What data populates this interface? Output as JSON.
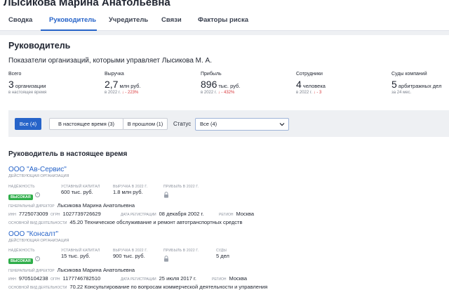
{
  "header": {
    "person_name": "Лысикова Марина Анатольевна"
  },
  "tabs": [
    {
      "label": "Сводка"
    },
    {
      "label": "Руководитель"
    },
    {
      "label": "Учредитель"
    },
    {
      "label": "Связи"
    },
    {
      "label": "Факторы риска"
    }
  ],
  "section": {
    "title": "Руководитель",
    "subtitle": "Показатели организаций, которыми управляет Лысикова М. А."
  },
  "stats": {
    "total": {
      "label": "Всего",
      "value": "3",
      "unit": "организации",
      "note": "в настоящее время"
    },
    "revenue": {
      "label": "Выручка",
      "value": "2,7",
      "unit": "млн руб.",
      "note": "в 2022 г.",
      "arrow": "↓",
      "change": "- 223%"
    },
    "profit": {
      "label": "Прибыль",
      "value": "896",
      "unit": "тыс. руб.",
      "note": "в 2022 г.",
      "arrow": "↓",
      "change": "- 432%"
    },
    "employees": {
      "label": "Сотрудники",
      "value": "4",
      "unit": "человека",
      "note": "в 2022 г.",
      "arrow": "↓",
      "change": "- 3"
    },
    "courts": {
      "label": "Суды компаний",
      "value": "5",
      "unit": "арбитражных дел",
      "note": "за 24 мес."
    }
  },
  "filters": {
    "all": "Все (4)",
    "current": "В настоящее время (3)",
    "past": "В прошлом (1)",
    "status_label": "Статус",
    "status_value": "Все (4)"
  },
  "current_title": "Руководитель в настоящее время",
  "orgs": [
    {
      "name": "ООО \"Ав-Сервис\"",
      "status": "ДЕЙСТВУЮЩАЯ ОРГАНИЗАЦИЯ",
      "reliability_label": "НАДЁЖНОСТЬ",
      "reliability": "ВЫСОКАЯ",
      "capital_label": "УСТАВНЫЙ КАПИТАЛ",
      "capital": "600 тыс. руб.",
      "revenue_label": "ВЫРУЧКА В 2022 Г.",
      "revenue": "1.8 млн руб.",
      "profit_label": "ПРИБЫЛЬ В 2022 Г.",
      "director_label": "ГЕНЕРАЛЬНЫЙ ДИРЕКТОР",
      "director": "Лысикова Марина Анатольевна",
      "inn_label": "ИНН",
      "inn": "7725073009",
      "ogrn_label": "ОГРН",
      "ogrn": "1027739726629",
      "reg_label": "ДАТА РЕГИСТРАЦИИ",
      "reg_date": "08 декабря 2002 г.",
      "region_label": "РЕГИОН",
      "region": "Москва",
      "activity_label": "ОСНОВНОЙ ВИД ДЕЯТЕЛЬНОСТИ",
      "activity": "45.20 Техническое обслуживание и ремонт автотранспортных средств"
    },
    {
      "name": "ООО \"Консалт\"",
      "status": "ДЕЙСТВУЮЩАЯ ОРГАНИЗАЦИЯ",
      "reliability_label": "НАДЁЖНОСТЬ",
      "reliability": "ВЫСОКАЯ",
      "capital_label": "УСТАВНЫЙ КАПИТАЛ",
      "capital": "15 тыс. руб.",
      "revenue_label": "ВЫРУЧКА В 2022 Г.",
      "revenue": "900 тыс. руб.",
      "profit_label": "ПРИБЫЛЬ В 2022 Г.",
      "courts_label": "СУДЫ",
      "courts": "5 дел",
      "director_label": "ГЕНЕРАЛЬНЫЙ ДИРЕКТОР",
      "director": "Лысикова Марина Анатольевна",
      "inn_label": "ИНН",
      "inn": "9705104238",
      "ogrn_label": "ОГРН",
      "ogrn": "1177746782510",
      "reg_label": "ДАТА РЕГИСТРАЦИИ",
      "reg_date": "25 июля 2017 г.",
      "region_label": "РЕГИОН",
      "region": "Москва",
      "activity_label": "ОСНОВНОЙ ВИД ДЕЯТЕЛЬНОСТИ",
      "activity": "70.22 Консультирование по вопросам коммерческой деятельности и управления"
    }
  ],
  "colors": {
    "accent": "#2764c9",
    "badge_green": "#2fae4a",
    "negative": "#d8393c"
  }
}
